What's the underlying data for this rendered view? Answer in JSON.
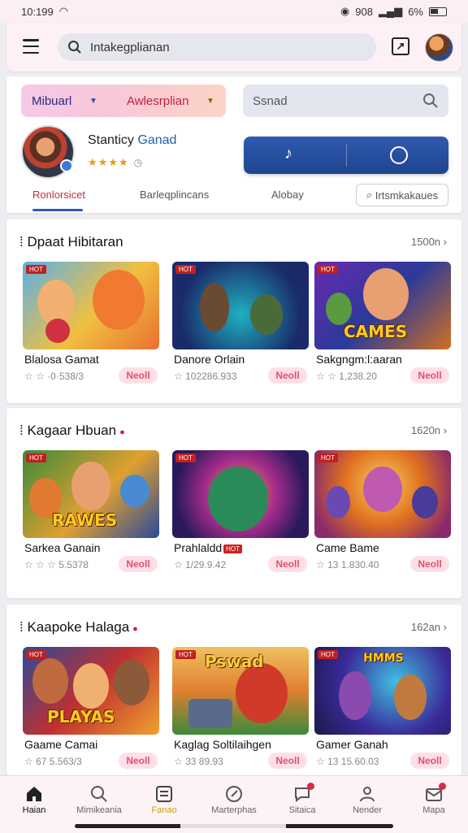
{
  "status_bar": {
    "time": "10:199",
    "right_text": "908",
    "battery_text": "6%"
  },
  "top_bar": {
    "search_text": "Intakegplianan"
  },
  "profile_card": {
    "select_option_1": "Mibuarl",
    "select_option_2": "Awlesrplian",
    "search_placeholder": "Ssnad",
    "name_part_1": "Stanticy",
    "name_part_2": "Ganad",
    "stars": "★★★★",
    "tabs": [
      "Ronlorsicet",
      "Barleqplincans",
      "Alobay"
    ],
    "tab_box": "Irtsmkakaues"
  },
  "sections": [
    {
      "title": "Dpaat Hibitaran",
      "count": "1500n",
      "cards": [
        {
          "title": "Blalosa Gamat",
          "meta": "☆ ☆ ·0·538/3",
          "button": "Neoll",
          "tag": "HOT"
        },
        {
          "title": "Danore Orlain",
          "meta": "☆ 102286.933",
          "button": "Neoll",
          "tag": "HOT"
        },
        {
          "title": "Sakgngm:l:aaran",
          "meta": "☆ ☆ 1,238.20",
          "button": "Neoll",
          "tag": "HOT",
          "logo": "CAMES"
        }
      ]
    },
    {
      "title": "Kagaar Hbuan",
      "count": "1620n",
      "cards": [
        {
          "title": "Sarkea Ganain",
          "meta": "☆ ☆ ☆ 5.5378",
          "button": "Neoll",
          "tag": "HOT",
          "logo": "RAWES"
        },
        {
          "title": "Prahlaldd",
          "meta": "☆ 1/29.9.42",
          "button": "Neoll",
          "tag": "HOT",
          "hot_label": "HOT"
        },
        {
          "title": "Came Bame",
          "meta": "☆ 13 1.830.40",
          "button": "Neoll",
          "tag": "HOT"
        }
      ]
    },
    {
      "title": "Kaapoke Halaga",
      "count": "162an",
      "cards": [
        {
          "title": "Gaame Camai",
          "meta": "☆ 67 5.563/3",
          "button": "Neoll",
          "tag": "HOT",
          "logo": "PLAYAS"
        },
        {
          "title": "Kaglag Soltilaihgen",
          "meta": "☆ 33 89.93",
          "button": "Neoll",
          "tag": "HOT",
          "logo": "Pswad"
        },
        {
          "title": "Gamer Ganah",
          "meta": "☆ 13 15.60.03",
          "button": "Neoll",
          "tag": "HOT",
          "logo": "HMMS"
        }
      ]
    }
  ],
  "bottom_nav": [
    "Haian",
    "Mimikeania",
    "Fanao",
    "Marterphas",
    "Sitaica",
    "Nender",
    "Mapa"
  ]
}
